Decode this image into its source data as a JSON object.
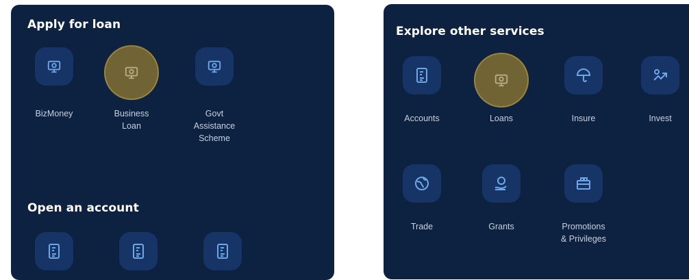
{
  "loan": {
    "title": "Apply for loan",
    "items": [
      {
        "label_1": "BizMoney",
        "label_2": "",
        "label_3": "",
        "icon": "monitor-dollar-icon"
      },
      {
        "label_1": "Business",
        "label_2": "Loan",
        "label_3": "",
        "icon": "monitor-dollar-icon"
      },
      {
        "label_1": "Govt",
        "label_2": "Assistance",
        "label_3": "Scheme",
        "icon": "monitor-dollar-icon"
      }
    ]
  },
  "account": {
    "title": "Open an account",
    "items": [
      {
        "icon": "document-dollar-icon"
      },
      {
        "icon": "document-dollar-icon"
      },
      {
        "icon": "document-dollar-icon"
      }
    ]
  },
  "services": {
    "title": "Explore other services",
    "items": [
      {
        "label_1": "Accounts",
        "label_2": "",
        "icon": "document-dollar-icon"
      },
      {
        "label_1": "Loans",
        "label_2": "",
        "icon": "monitor-dollar-icon"
      },
      {
        "label_1": "Insure",
        "label_2": "",
        "icon": "umbrella-icon"
      },
      {
        "label_1": "Invest",
        "label_2": "",
        "icon": "chart-dollar-icon"
      },
      {
        "label_1": "Trade",
        "label_2": "",
        "icon": "globe-icon"
      },
      {
        "label_1": "Grants",
        "label_2": "",
        "icon": "hand-coin-icon"
      },
      {
        "label_1": "Promotions",
        "label_2": "& Privileges",
        "icon": "gift-card-icon"
      }
    ]
  },
  "colors": {
    "panel_bg": "#0d2241",
    "tile_bg": "#163465",
    "icon_color": "#6fa8e8",
    "highlight": "#706334"
  }
}
